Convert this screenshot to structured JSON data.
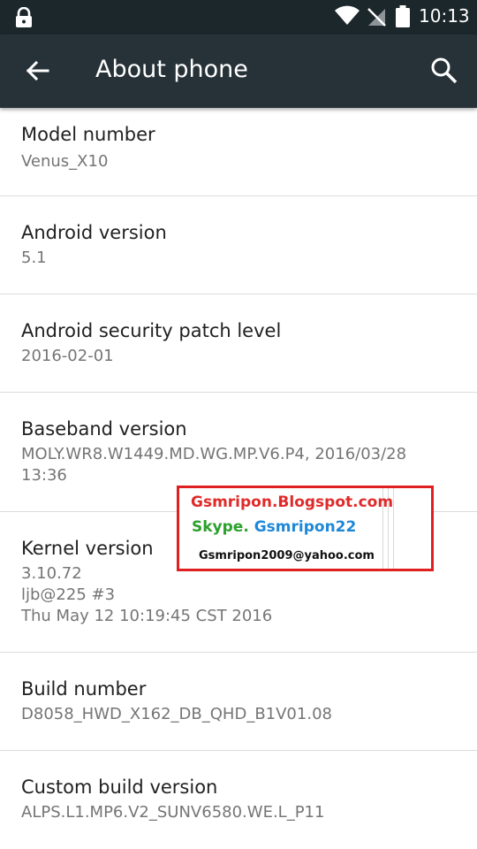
{
  "status_bar": {
    "time": "10:13",
    "icons": [
      "lock-icon",
      "wifi-icon",
      "no-signal-icon",
      "battery-icon"
    ]
  },
  "app_bar": {
    "title": "About phone",
    "back_icon": "arrow-back-icon",
    "search_icon": "search-icon",
    "background": "#263238"
  },
  "items": [
    {
      "label": "Model number",
      "value": "Venus_X10"
    },
    {
      "label": "Android version",
      "value": "5.1"
    },
    {
      "label": "Android security patch level",
      "value": "2016-02-01"
    },
    {
      "label": "Baseband version",
      "value": "MOLY.WR8.W1449.MD.WG.MP.V6.P4, 2016/03/28\n13:36"
    },
    {
      "label": "Kernel version",
      "value": "3.10.72\nljb@225 #3\nThu May 12 10:19:45 CST 2016"
    },
    {
      "label": "Build number",
      "value": "D8058_HWD_X162_DB_QHD_B1V01.08"
    },
    {
      "label": "Custom build version",
      "value": "ALPS.L1.MP6.V2_SUNV6580.WE.L_P11"
    }
  ],
  "watermark": {
    "line1": "Gsmripon.Blogspot.com",
    "line2_a": "Skype. ",
    "line2_b": "Gsmripon22",
    "line3": "Gsmripon2009@yahoo.com",
    "border_color": "#e02020"
  }
}
